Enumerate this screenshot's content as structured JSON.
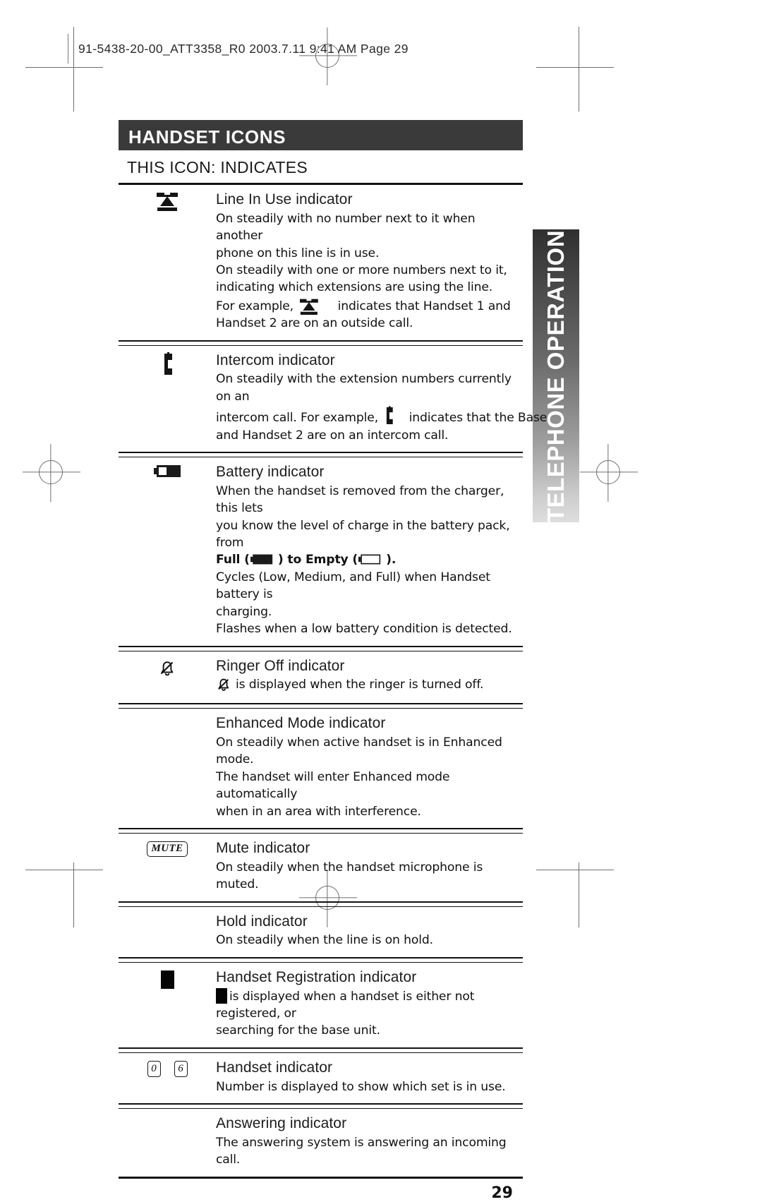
{
  "print_slug": "91-5438-20-00_ATT3358_R0  2003.7.11  9:41 AM  Page 29",
  "side_tab": {
    "label": "TELEPHONE OPERATION"
  },
  "header": {
    "title": "HANDSET ICONS",
    "column_header": "THIS ICON:  INDICATES"
  },
  "rows": [
    {
      "icon": "line-in-use-phone-icon",
      "name": "Line In Use indicator",
      "desc_lines": [
        "On steadily with no number next to it when another",
        "phone on this line is in use.",
        "On steadily with one or more numbers next to it,",
        "indicating which extensions are using the line."
      ],
      "example_prefix": "For example,",
      "example_suffix": "indicates that Handset 1 and",
      "example_tail": "Handset 2 are on an outside call."
    },
    {
      "icon": "intercom-icon",
      "name": "Intercom indicator",
      "desc_lines": [
        "On steadily with the extension numbers currently on an"
      ],
      "example_prefix": "intercom call. For example,",
      "example_suffix": "indicates that the Base",
      "example_tail": "and Handset 2 are on an intercom call."
    },
    {
      "icon": "battery-icon",
      "name": "Battery indicator",
      "desc_lines": [
        "When the handset is removed from the charger, this lets",
        "you know the level of charge in the battery pack, from"
      ],
      "full_label": "Full (",
      "mid_label": ") to Empty (",
      "end_label": ").",
      "tail_lines": [
        "Cycles (Low, Medium, and Full) when Handset battery is",
        "charging.",
        "Flashes when a low battery condition is detected."
      ]
    },
    {
      "icon": "ringer-off-bell-icon",
      "name": "Ringer Off indicator",
      "inline_suffix": "is displayed when the ringer is turned off."
    },
    {
      "icon": "none",
      "name": "Enhanced Mode indicator",
      "desc_lines": [
        "On steadily when active handset is in Enhanced mode.",
        "The handset will enter Enhanced mode automatically",
        "when in an area with interference."
      ]
    },
    {
      "icon": "mute-badge-icon",
      "name": "Mute indicator",
      "desc_lines": [
        "On steadily when the handset microphone is muted."
      ]
    },
    {
      "icon": "none",
      "name": "Hold indicator",
      "desc_lines": [
        "On steadily when the line is on hold."
      ]
    },
    {
      "icon": "black-square-icon",
      "name": "Handset Registration indicator",
      "inline_suffix": "is displayed when a handset is either not registered, or",
      "desc_lines": [
        "searching for the base unit."
      ]
    },
    {
      "icon": "handset-number-badges-icon",
      "name": "Handset indicator",
      "badge_values": [
        "0",
        "6"
      ],
      "desc_lines": [
        "Number is displayed to show which set is in use."
      ]
    },
    {
      "icon": "none",
      "name": "Answering indicator",
      "desc_lines": [
        "The answering system is answering an incoming call."
      ]
    }
  ],
  "page_number": "29"
}
